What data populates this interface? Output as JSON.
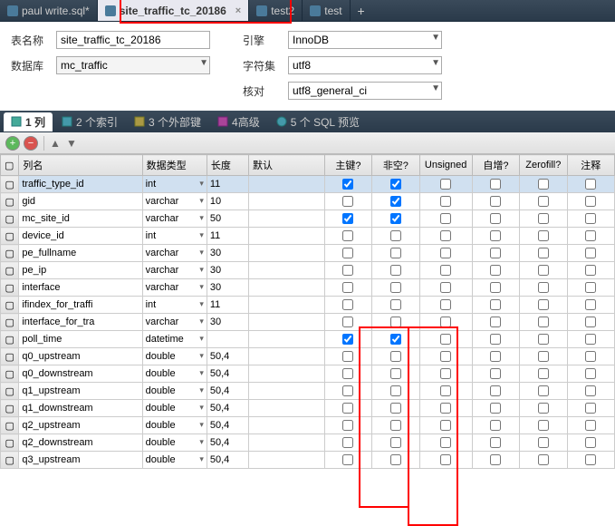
{
  "tabs": [
    {
      "label": "paul write.sql*",
      "active": false
    },
    {
      "label": "site_traffic_tc_20186",
      "active": true
    },
    {
      "label": "test2",
      "active": false
    },
    {
      "label": "test",
      "active": false
    }
  ],
  "form": {
    "table_name_label": "表名称",
    "table_name_value": "site_traffic_tc_20186",
    "engine_label": "引擎",
    "engine_value": "InnoDB",
    "database_label": "数据库",
    "database_value": "mc_traffic",
    "charset_label": "字符集",
    "charset_value": "utf8",
    "collation_label": "核对",
    "collation_value": "utf8_general_ci"
  },
  "sub_tabs": {
    "columns": "1 列",
    "indexes": "2 个索引",
    "fkeys": "3 个外部键",
    "advanced": "4高级",
    "sql": "5 个 SQL 预览"
  },
  "grid": {
    "headers": {
      "name": "列名",
      "type": "数据类型",
      "length": "长度",
      "default": "默认",
      "pk": "主键?",
      "notnull": "非空?",
      "unsigned": "Unsigned",
      "autoinc": "自增?",
      "zerofill": "Zerofill?",
      "comment": "注释"
    },
    "rows": [
      {
        "name": "traffic_type_id",
        "type": "int",
        "len": "11",
        "def": "",
        "pk": true,
        "nn": true,
        "un": false,
        "ai": false,
        "zf": false,
        "sel": true
      },
      {
        "name": "gid",
        "type": "varchar",
        "len": "10",
        "def": "",
        "pk": false,
        "nn": true,
        "un": false,
        "ai": false,
        "zf": false
      },
      {
        "name": "mc_site_id",
        "type": "varchar",
        "len": "50",
        "def": "",
        "pk": true,
        "nn": true,
        "un": false,
        "ai": false,
        "zf": false
      },
      {
        "name": "device_id",
        "type": "int",
        "len": "11",
        "def": "",
        "pk": false,
        "nn": false,
        "un": false,
        "ai": false,
        "zf": false
      },
      {
        "name": "pe_fullname",
        "type": "varchar",
        "len": "30",
        "def": "",
        "pk": false,
        "nn": false,
        "un": false,
        "ai": false,
        "zf": false
      },
      {
        "name": "pe_ip",
        "type": "varchar",
        "len": "30",
        "def": "",
        "pk": false,
        "nn": false,
        "un": false,
        "ai": false,
        "zf": false
      },
      {
        "name": "interface",
        "type": "varchar",
        "len": "30",
        "def": "",
        "pk": false,
        "nn": false,
        "un": false,
        "ai": false,
        "zf": false
      },
      {
        "name": "ifindex_for_traffi",
        "type": "int",
        "len": "11",
        "def": "",
        "pk": false,
        "nn": false,
        "un": false,
        "ai": false,
        "zf": false
      },
      {
        "name": "interface_for_tra",
        "type": "varchar",
        "len": "30",
        "def": "",
        "pk": false,
        "nn": false,
        "un": false,
        "ai": false,
        "zf": false
      },
      {
        "name": "poll_time",
        "type": "datetime",
        "len": "",
        "def": "",
        "pk": true,
        "nn": true,
        "un": false,
        "ai": false,
        "zf": false
      },
      {
        "name": "q0_upstream",
        "type": "double",
        "len": "50,4",
        "def": "",
        "pk": false,
        "nn": false,
        "un": false,
        "ai": false,
        "zf": false
      },
      {
        "name": "q0_downstream",
        "type": "double",
        "len": "50,4",
        "def": "",
        "pk": false,
        "nn": false,
        "un": false,
        "ai": false,
        "zf": false
      },
      {
        "name": "q1_upstream",
        "type": "double",
        "len": "50,4",
        "def": "",
        "pk": false,
        "nn": false,
        "un": false,
        "ai": false,
        "zf": false
      },
      {
        "name": "q1_downstream",
        "type": "double",
        "len": "50,4",
        "def": "",
        "pk": false,
        "nn": false,
        "un": false,
        "ai": false,
        "zf": false
      },
      {
        "name": "q2_upstream",
        "type": "double",
        "len": "50,4",
        "def": "",
        "pk": false,
        "nn": false,
        "un": false,
        "ai": false,
        "zf": false
      },
      {
        "name": "q2_downstream",
        "type": "double",
        "len": "50,4",
        "def": "",
        "pk": false,
        "nn": false,
        "un": false,
        "ai": false,
        "zf": false
      },
      {
        "name": "q3_upstream",
        "type": "double",
        "len": "50,4",
        "def": "",
        "pk": false,
        "nn": false,
        "un": false,
        "ai": false,
        "zf": false
      }
    ]
  }
}
